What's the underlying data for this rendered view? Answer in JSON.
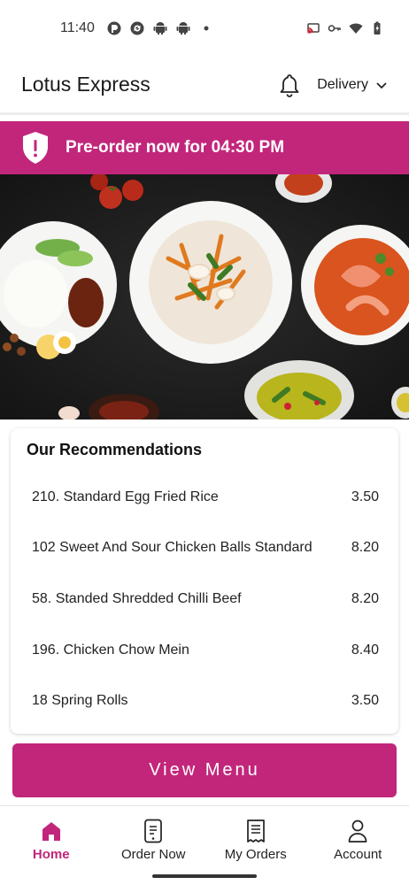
{
  "status_bar": {
    "time": "11:40",
    "left_icons": [
      "pocket-icon",
      "sync-icon",
      "android-icon",
      "android-icon",
      "dot-icon"
    ],
    "right_icons": [
      "cast-icon",
      "key-icon",
      "wifi-icon",
      "battery-icon"
    ]
  },
  "header": {
    "title": "Lotus Express",
    "delivery_label": "Delivery"
  },
  "preorder": {
    "text": "Pre-order now for 04:30 PM"
  },
  "recommendations": {
    "title": "Our Recommendations",
    "items": [
      {
        "name": "210. Standard Egg Fried Rice",
        "price": "3.50"
      },
      {
        "name": "102 Sweet And Sour Chicken Balls Standard",
        "price": "8.20"
      },
      {
        "name": "58. Standed Shredded Chilli Beef",
        "price": "8.20"
      },
      {
        "name": "196. Chicken Chow Mein",
        "price": "8.40"
      },
      {
        "name": "18 Spring Rolls",
        "price": "3.50"
      }
    ]
  },
  "view_menu_label": "View Menu",
  "bottom_nav": {
    "items": [
      {
        "label": "Home",
        "icon": "home-icon",
        "active": true
      },
      {
        "label": "Order Now",
        "icon": "phone-icon",
        "active": false
      },
      {
        "label": "My Orders",
        "icon": "receipt-icon",
        "active": false
      },
      {
        "label": "Account",
        "icon": "user-icon",
        "active": false
      }
    ]
  },
  "colors": {
    "brand": "#c2267b",
    "text": "#1a1a1a"
  }
}
